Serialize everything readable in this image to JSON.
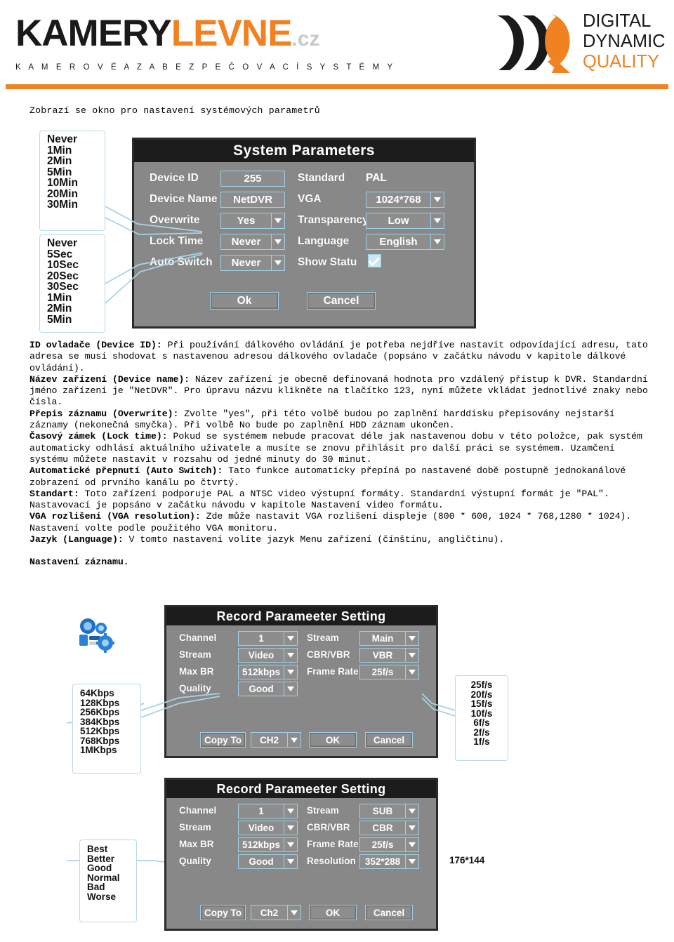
{
  "header": {
    "logo_primary_dark": "KAMERY",
    "logo_primary_accent": "LEVNE",
    "logo_tld": ".cz",
    "logo_tagline": "K A M E R O V É   A   Z A B E Z P E Č O V A C Í   S Y S T É M Y",
    "brand_line1": "DIGITAL",
    "brand_line2": "DYNAMIC",
    "brand_line3": "QUALITY",
    "accent_color": "#f08222",
    "dark_color": "#1a1a1a",
    "tld_color": "#c9c9c9"
  },
  "intro": {
    "text": "Zobrazí se okno pro nastavení systémových parametrů"
  },
  "system_parameters_figure": {
    "lock_time_options": [
      "Never",
      "1Min",
      "2Min",
      "5Min",
      "10Min",
      "20Min",
      "30Min"
    ],
    "auto_switch_options": [
      "Never",
      "5Sec",
      "10Sec",
      "20Sec",
      "30Sec",
      "1Min",
      "2Min",
      "5Min"
    ],
    "dialog": {
      "title": "System Parameters",
      "fields": [
        {
          "label": "Device ID",
          "value": "255",
          "type": "text"
        },
        {
          "label": "Device Name",
          "value": "NetDVR",
          "type": "text"
        },
        {
          "label": "Overwrite",
          "value": "Yes",
          "type": "dropdown"
        },
        {
          "label": "Lock Time",
          "value": "Never",
          "type": "dropdown"
        },
        {
          "label": "Auto Switch",
          "value": "Never",
          "type": "dropdown"
        },
        {
          "label": "Standard",
          "value": "PAL",
          "type": "plain"
        },
        {
          "label": "VGA",
          "value": "1024*768",
          "type": "dropdown"
        },
        {
          "label": "Transparency",
          "value": "Low",
          "type": "dropdown"
        },
        {
          "label": "Language",
          "value": "English",
          "type": "dropdown"
        },
        {
          "label": "Show Statu",
          "value": "checked",
          "type": "checkbox"
        }
      ],
      "ok_label": "Ok",
      "cancel_label": "Cancel"
    }
  },
  "body": {
    "paragraphs": [
      {
        "bold": "ID ovladače (Device ID):",
        "text": " Při používání dálkového ovládání je potřeba nejdříve nastavit odpovídající adresu, tato adresa se musí shodovat s nastavenou adresou dálkového ovladače (popsáno v začátku návodu v kapitole dálkové ovládání)."
      },
      {
        "bold": "Název zařízení (Device name):",
        "text": " Název zařízení je obecně definovaná hodnota pro vzdálený přístup k DVR. Standardní jméno zařízení je \"NetDVR\". Pro úpravu názvu klikněte na tlačítko 123, nyní můžete vkládat jednotlivé znaky nebo čísla."
      },
      {
        "bold": "Přepis záznamu (Overwrite):",
        "text": " Zvolte \"yes\", při této volbě budou po zaplnění harddisku přepisovány nejstarší záznamy (nekonečná smyčka). Při volbě No bude po zaplnění HDD záznam ukončen."
      },
      {
        "bold": "Časový zámek (Lock time):",
        "text": " Pokud se systémem nebude pracovat déle jak nastavenou dobu v této položce, pak systém automaticky odhlásí aktuálního uživatele a musíte se znovu přihlásit pro další práci se systémem. Uzamčení systému můžete nastavit v rozsahu od jedné minuty do 30 minut."
      },
      {
        "bold": "Automatické přepnutí (Auto Switch):",
        "text": " Tato funkce automaticky přepíná po nastavené době postupně jednokanálové zobrazení od prvního kanálu po čtvrtý."
      },
      {
        "bold": "Standart:",
        "text": " Toto zařízení podporuje PAL a NTSC video výstupní formáty. Standardní výstupní formát je \"PAL\". Nastavovací je popsáno v začátku návodu v kapitole Nastavení video formátu."
      },
      {
        "bold": "VGA rozlišení (VGA resolution):",
        "text": " Zde může nastavit VGA rozlišení displeje (800 * 600, 1024 * 768,1280 * 1024). Nastavení volte podle použitého VGA monitoru."
      },
      {
        "bold": "Jazyk (Language):",
        "text": " V tomto nastavení volíte jazyk Menu zařízení (čínštinu, angličtinu)."
      }
    ],
    "closing_heading": "Nastavení záznamu."
  },
  "record_figure_main": {
    "icon": "settings-icon",
    "max_br_options": [
      "64Kbps",
      "128Kbps",
      "256Kbps",
      "384Kbps",
      "512Kbps",
      "768Kbps",
      "1MKbps"
    ],
    "frame_rate_options": [
      "25f/s",
      "20f/s",
      "15f/s",
      "10f/s",
      "6f/s",
      "2f/s",
      "1f/s"
    ],
    "dialog": {
      "title": "Record Parameeter Setting",
      "fields": [
        {
          "label": "Channel",
          "value": "1",
          "type": "dropdown"
        },
        {
          "label": "Stream",
          "value": "Video",
          "type": "dropdown"
        },
        {
          "label": "Max BR",
          "value": "512kbps",
          "type": "dropdown"
        },
        {
          "label": "Quality",
          "value": "Good",
          "type": "dropdown"
        },
        {
          "label": "Stream",
          "value": "Main",
          "type": "dropdown"
        },
        {
          "label": "CBR/VBR",
          "value": "VBR",
          "type": "dropdown"
        },
        {
          "label": "Frame Rate",
          "value": "25f/s",
          "type": "dropdown"
        }
      ],
      "copy_to_label": "Copy To",
      "copy_to_value": "CH2",
      "ok_label": "OK",
      "cancel_label": "Cancel"
    }
  },
  "record_figure_sub": {
    "quality_options": [
      "Best",
      "Better",
      "Good",
      "Normal",
      "Bad",
      "Worse"
    ],
    "resolution_note": "176*144",
    "dialog": {
      "title": "Record Parameeter Setting",
      "fields": [
        {
          "label": "Channel",
          "value": "1",
          "type": "dropdown"
        },
        {
          "label": "Stream",
          "value": "Video",
          "type": "dropdown"
        },
        {
          "label": "Max BR",
          "value": "512kbps",
          "type": "dropdown"
        },
        {
          "label": "Quality",
          "value": "Good",
          "type": "dropdown"
        },
        {
          "label": "Stream",
          "value": "SUB",
          "type": "dropdown"
        },
        {
          "label": "CBR/VBR",
          "value": "CBR",
          "type": "dropdown"
        },
        {
          "label": "Frame Rate",
          "value": "25f/s",
          "type": "dropdown"
        },
        {
          "label": "Resolution",
          "value": "352*288",
          "type": "dropdown"
        }
      ],
      "copy_to_label": "Copy To",
      "copy_to_value": "Ch2",
      "ok_label": "OK",
      "cancel_label": "Cancel"
    }
  }
}
